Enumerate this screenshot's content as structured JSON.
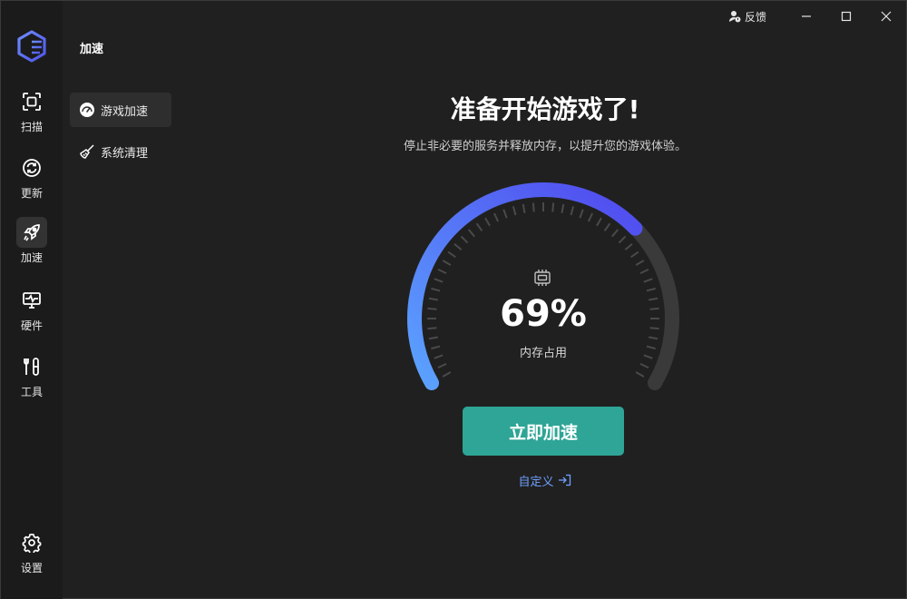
{
  "app": {
    "brand_colors": {
      "primary": "#5a63f0",
      "accent": "#2ea596",
      "link": "#6fa0ff",
      "background": "#202020"
    }
  },
  "titlebar": {
    "feedback_label": "反馈",
    "feedback_icon": "user-feedback-icon",
    "minimize_icon": "minimize-icon",
    "maximize_icon": "maximize-icon",
    "close_icon": "close-icon"
  },
  "rail": {
    "items": [
      {
        "label": "扫描",
        "icon": "scan-icon",
        "active": false
      },
      {
        "label": "更新",
        "icon": "refresh-icon",
        "active": false
      },
      {
        "label": "加速",
        "icon": "rocket-icon",
        "active": true
      },
      {
        "label": "硬件",
        "icon": "monitor-pulse-icon",
        "active": false
      },
      {
        "label": "工具",
        "icon": "tools-icon",
        "active": false
      }
    ],
    "settings": {
      "label": "设置",
      "icon": "gear-icon"
    }
  },
  "subnav": {
    "section_title": "加速",
    "items": [
      {
        "label": "游戏加速",
        "icon": "speedometer-icon",
        "active": true
      },
      {
        "label": "系统清理",
        "icon": "broom-icon",
        "active": false
      }
    ]
  },
  "main": {
    "title": "准备开始游戏了!",
    "subtitle": "停止非必要的服务并释放内存，以提升您的游戏体验。",
    "gauge": {
      "percent_text": "69%",
      "value": 69,
      "label": "内存占用",
      "icon": "memory-chip-icon"
    },
    "boost_button": "立即加速",
    "custom_link": "自定义"
  }
}
